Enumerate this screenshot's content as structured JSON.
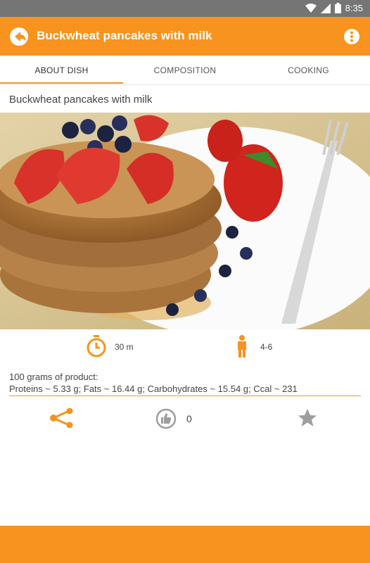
{
  "status_bar": {
    "time": "8:35"
  },
  "app_bar": {
    "title": "Buckwheat pancakes with milk",
    "back_icon": "back-arrow-icon",
    "menu_icon": "more-vert-icon"
  },
  "tabs": [
    {
      "label": "ABOUT DISH",
      "active": true
    },
    {
      "label": "COMPOSITION",
      "active": false
    },
    {
      "label": "COOKING",
      "active": false
    }
  ],
  "dish": {
    "title": "Buckwheat pancakes with milk",
    "time": "30 m",
    "servings": "4-6"
  },
  "nutrition": {
    "header": "100 grams of product:",
    "line": "Proteins ~ 5.33 g; Fats ~ 16.44 g; Carbohydrates ~ 15.54 g; Ccal ~ 231"
  },
  "actions": {
    "likes": "0"
  },
  "colors": {
    "accent": "#f7931e",
    "status_bar": "#757575",
    "icon_grey": "#9e9e9e"
  }
}
